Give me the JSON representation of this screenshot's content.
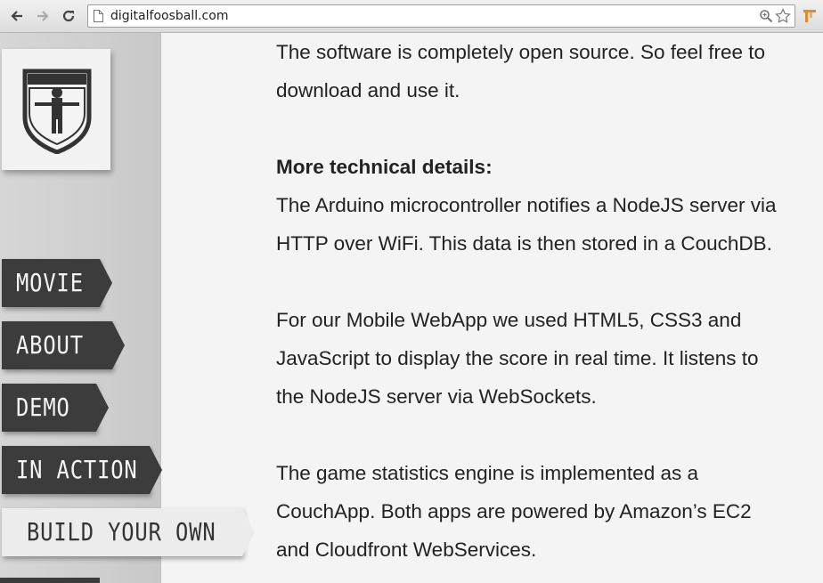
{
  "browser": {
    "url": "digitalfoosball.com",
    "icons": [
      "back-arrow-icon",
      "forward-arrow-icon",
      "reload-icon",
      "page-icon",
      "zoom-icon",
      "bookmark-star-icon",
      "extension-icon"
    ]
  },
  "sidebar": {
    "logo_icon": "foosball-shield-logo",
    "menu": [
      {
        "label": "MOVIE",
        "active": false
      },
      {
        "label": "ABOUT",
        "active": false
      },
      {
        "label": "DEMO",
        "active": false
      },
      {
        "label": "IN ACTION",
        "active": false
      },
      {
        "label": "BUILD YOUR OWN",
        "active": true
      }
    ]
  },
  "content": {
    "lines": [
      "The software is completely open source. So feel free to",
      "download and use it.",
      "More technical details:",
      "The Arduino microcontroller notifies a NodeJS server via",
      "HTTP over WiFi. This data is then stored in a CouchDB.",
      "For our Mobile WebApp we used HTML5, CSS3 and",
      "JavaScript to display the score in real time. It listens to",
      "the NodeJS server via WebSockets.",
      "The game statistics engine is implemented as a",
      "CouchApp. Both apps are powered by Amazon’s EC2",
      "and Cloudfront WebServices."
    ]
  },
  "colors": {
    "menu_bg": "#3c3c3c",
    "menu_active_bg": "#ececec",
    "sidebar_bg": "#d3d3d3",
    "page_bg": "#f4f4f4",
    "text": "#222222"
  }
}
